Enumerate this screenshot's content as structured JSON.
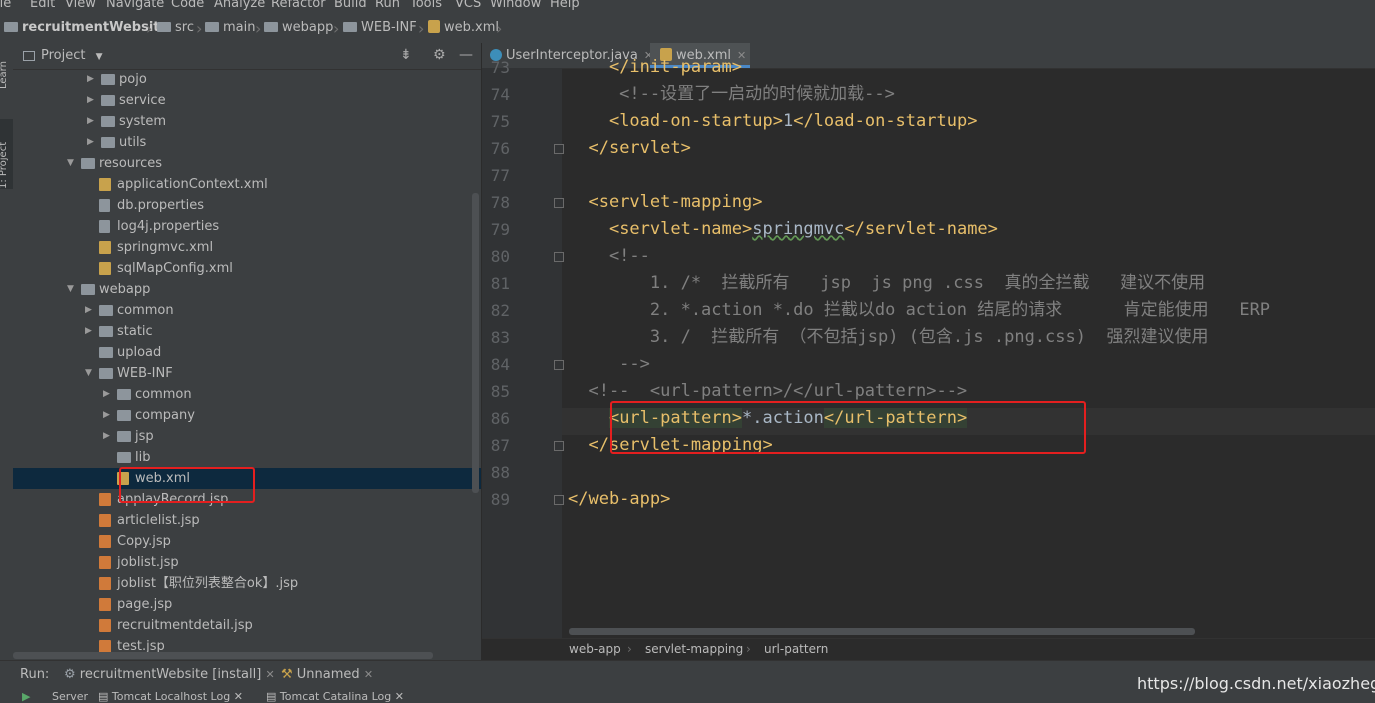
{
  "menu": [
    "ile",
    "Edit",
    "View",
    "Navigate",
    "Code",
    "Analyze",
    "Refactor",
    "Build",
    "Run",
    "Tools",
    "VCS",
    "Window",
    "Help"
  ],
  "breadcrumbs": [
    "recruitmentWebsite",
    "src",
    "main",
    "webapp",
    "WEB-INF",
    "web.xml"
  ],
  "left_tabs": [
    "Learn",
    "1: Project"
  ],
  "project_panel": {
    "title": "Project"
  },
  "tree": [
    {
      "label": "pojo",
      "icon": "package-icon",
      "expandable": true
    },
    {
      "label": "service",
      "icon": "package-icon",
      "expandable": true
    },
    {
      "label": "system",
      "icon": "package-icon",
      "expandable": true
    },
    {
      "label": "utils",
      "icon": "package-icon",
      "expandable": true
    },
    {
      "label": "resources",
      "icon": "resources-folder-icon",
      "expanded": true
    },
    {
      "label": "applicationContext.xml",
      "icon": "xml-file-icon"
    },
    {
      "label": "db.properties",
      "icon": "properties-file-icon"
    },
    {
      "label": "log4j.properties",
      "icon": "properties-file-icon"
    },
    {
      "label": "springmvc.xml",
      "icon": "xml-file-icon"
    },
    {
      "label": "sqlMapConfig.xml",
      "icon": "xml-file-icon"
    },
    {
      "label": "webapp",
      "icon": "folder-icon",
      "expanded": true
    },
    {
      "label": "common",
      "icon": "folder-icon",
      "expandable": true
    },
    {
      "label": "static",
      "icon": "folder-icon",
      "expandable": true
    },
    {
      "label": "upload",
      "icon": "folder-icon"
    },
    {
      "label": "WEB-INF",
      "icon": "folder-icon",
      "expanded": true
    },
    {
      "label": "common",
      "icon": "folder-icon",
      "expandable": true
    },
    {
      "label": "company",
      "icon": "folder-icon",
      "expandable": true
    },
    {
      "label": "jsp",
      "icon": "folder-icon",
      "expandable": true
    },
    {
      "label": "lib",
      "icon": "folder-icon"
    },
    {
      "label": "web.xml",
      "icon": "xml-file-icon",
      "selected": true
    },
    {
      "label": "applayRecord.jsp",
      "icon": "jsp-file-icon"
    },
    {
      "label": "articlelist.jsp",
      "icon": "jsp-file-icon"
    },
    {
      "label": "Copy.jsp",
      "icon": "jsp-file-icon"
    },
    {
      "label": "joblist.jsp",
      "icon": "jsp-file-icon"
    },
    {
      "label": "joblist【职位列表整合ok】.jsp",
      "icon": "jsp-file-icon"
    },
    {
      "label": "page.jsp",
      "icon": "jsp-file-icon"
    },
    {
      "label": "recruitmentdetail.jsp",
      "icon": "jsp-file-icon"
    },
    {
      "label": "test.jsp",
      "icon": "jsp-file-icon"
    }
  ],
  "editor_tabs": [
    {
      "label": "UserInterceptor.java",
      "active": false
    },
    {
      "label": "web.xml",
      "active": true
    }
  ],
  "code_lines": [
    {
      "num": "73",
      "text": "    </init-param>"
    },
    {
      "num": "74",
      "text": "     <!--设置了一启动的时候就加载-->"
    },
    {
      "num": "75",
      "text": "    <load-on-startup>1</load-on-startup>"
    },
    {
      "num": "76",
      "text": "  </servlet>"
    },
    {
      "num": "77",
      "text": ""
    },
    {
      "num": "78",
      "text": "  <servlet-mapping>"
    },
    {
      "num": "79",
      "text": "    <servlet-name>springmvc</servlet-name>"
    },
    {
      "num": "80",
      "text": "    <!--"
    },
    {
      "num": "81",
      "text": "        1. /*  拦截所有   jsp  js png .css  真的全拦截   建议不使用"
    },
    {
      "num": "82",
      "text": "        2. *.action *.do 拦截以do action 结尾的请求      肯定能使用   ERP"
    },
    {
      "num": "83",
      "text": "        3. /  拦截所有 （不包括jsp) (包含.js .png.css)  强烈建议使用"
    },
    {
      "num": "84",
      "text": "     -->"
    },
    {
      "num": "85",
      "text": "  <!--  <url-pattern>/</url-pattern>-->"
    },
    {
      "num": "86",
      "text": "    <url-pattern>*.action</url-pattern>"
    },
    {
      "num": "87",
      "text": "  </servlet-mapping>"
    },
    {
      "num": "88",
      "text": ""
    },
    {
      "num": "89",
      "text": "</web-app>"
    }
  ],
  "editor_breadcrumbs": [
    "web-app",
    "servlet-mapping",
    "url-pattern"
  ],
  "run_bar": {
    "label": "Run:",
    "config": "recruitmentWebsite [install]",
    "unnamed": "Unnamed"
  },
  "run_tabs": [
    "Server",
    "Tomcat Localhost Log",
    "Tomcat Catalina Log"
  ],
  "watermark": "https://blog.csdn.net/xiaozhegaa",
  "colors": {
    "highlight_box": "#e41f1f",
    "tag": "#e8bf6a",
    "comment": "#808080",
    "selection": "#0d293e"
  }
}
